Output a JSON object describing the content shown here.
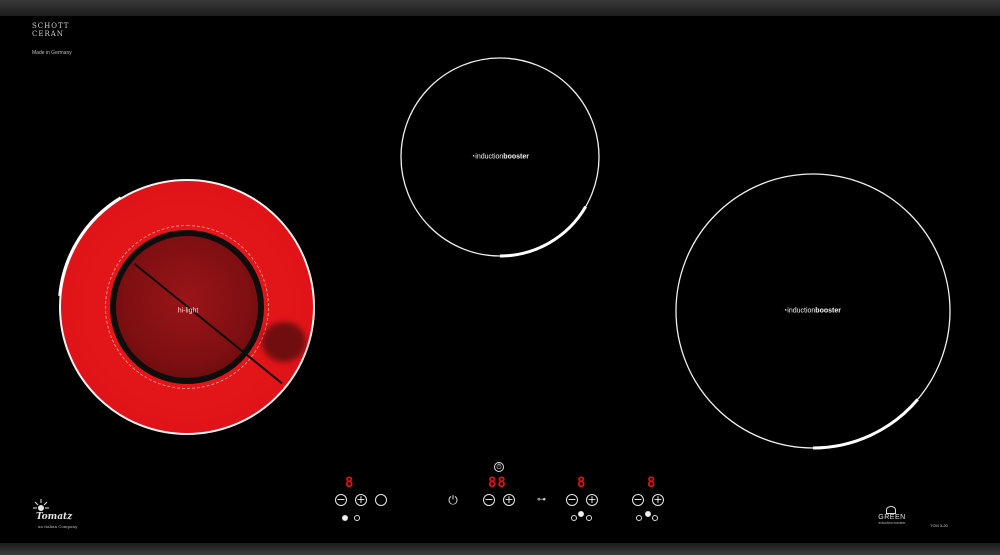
{
  "brand": {
    "glass_logo": "SCHOTT CERAN",
    "made_in": "Made in Germany",
    "maker_logo": "Tomatz",
    "maker_sub": "an italian Company",
    "green_logo": "GREEN",
    "green_sub": "induction booster",
    "model": "TCM 3-20"
  },
  "zones": {
    "hilight": {
      "label": "hi-light",
      "active": true
    },
    "top_center": {
      "label_light": "induction",
      "label_bold": "booster",
      "active": false
    },
    "right": {
      "label_light": "induction",
      "label_bold": "booster",
      "active": false
    }
  },
  "controls": {
    "left": {
      "display": "8",
      "minus": "−",
      "plus": "+"
    },
    "center": {
      "display": "88",
      "minus": "−",
      "plus": "+"
    },
    "right_a": {
      "display": "8",
      "minus": "−",
      "plus": "+"
    },
    "right_b": {
      "display": "8",
      "minus": "−",
      "plus": "+"
    }
  },
  "colors": {
    "hotplate_red": "#e01418",
    "display_red": "#e21212",
    "ring_white": "#f0f0f0"
  },
  "icons": [
    "power-icon",
    "lock-icon",
    "timer-icon",
    "minus-icon",
    "plus-icon"
  ]
}
